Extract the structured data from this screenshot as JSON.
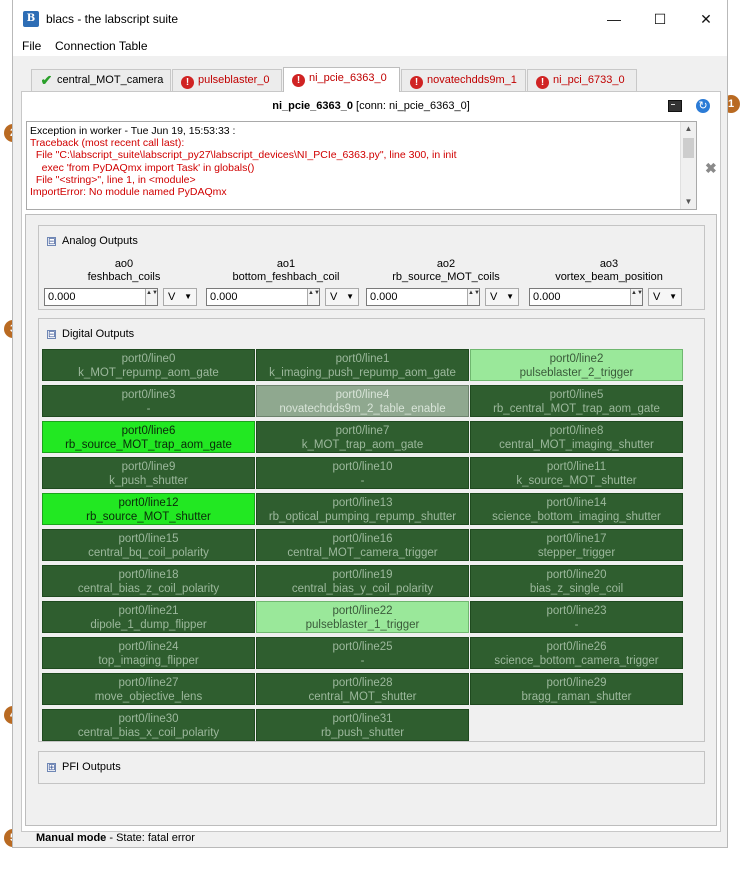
{
  "window": {
    "title": "blacs - the labscript suite",
    "app_icon": "B",
    "min_icon": "—",
    "max_icon": "☐",
    "close_icon": "✕"
  },
  "menu": [
    "File",
    "Connection Table"
  ],
  "tabs": [
    {
      "label": "central_MOT_camera",
      "status": "ok"
    },
    {
      "label": "pulseblaster_0",
      "status": "error"
    },
    {
      "label": "ni_pcie_6363_0",
      "status": "error",
      "active": true
    },
    {
      "label": "novatechdds9m_1",
      "status": "error"
    },
    {
      "label": "ni_pci_6733_0",
      "status": "error"
    }
  ],
  "header": {
    "device": "ni_pcie_6363_0",
    "conn": "[conn: ni_pcie_6363_0]"
  },
  "error_lines": [
    "Exception in worker - Tue Jun 19, 15:53:33 :",
    "Traceback (most recent call last):",
    "  File \"C:\\labscript_suite\\labscript_py27\\labscript_devices\\NI_PCIe_6363.py\", line 300, in init",
    "    exec 'from PyDAQmx import Task' in globals()",
    "  File \"<string>\", line 1, in <module>",
    "ImportError: No module named PyDAQmx"
  ],
  "analog": {
    "title": "Analog Outputs",
    "expander": "⊟",
    "items": [
      {
        "ch": "ao0",
        "name": "feshbach_coils",
        "value": "0.000",
        "unit": "V"
      },
      {
        "ch": "ao1",
        "name": "bottom_feshbach_coil",
        "value": "0.000",
        "unit": "V"
      },
      {
        "ch": "ao2",
        "name": "rb_source_MOT_coils",
        "value": "0.000",
        "unit": "V"
      },
      {
        "ch": "ao3",
        "name": "vortex_beam_position",
        "value": "0.000",
        "unit": "V"
      }
    ]
  },
  "digital": {
    "title": "Digital Outputs",
    "expander": "⊟",
    "items": [
      {
        "port": "port0/line0",
        "name": "k_MOT_repump_aom_gate",
        "state": "off"
      },
      {
        "port": "port0/line1",
        "name": "k_imaging_push_repump_aom_gate",
        "state": "off"
      },
      {
        "port": "port0/line2",
        "name": "pulseblaster_2_trigger",
        "state": "light"
      },
      {
        "port": "port0/line3",
        "name": "-",
        "state": "off"
      },
      {
        "port": "port0/line4",
        "name": "novatechdds9m_2_table_enable",
        "state": "disabled"
      },
      {
        "port": "port0/line5",
        "name": "rb_central_MOT_trap_aom_gate",
        "state": "off"
      },
      {
        "port": "port0/line6",
        "name": "rb_source_MOT_trap_aom_gate",
        "state": "on"
      },
      {
        "port": "port0/line7",
        "name": "k_MOT_trap_aom_gate",
        "state": "off"
      },
      {
        "port": "port0/line8",
        "name": "central_MOT_imaging_shutter",
        "state": "off"
      },
      {
        "port": "port0/line9",
        "name": "k_push_shutter",
        "state": "off"
      },
      {
        "port": "port0/line10",
        "name": "-",
        "state": "off"
      },
      {
        "port": "port0/line11",
        "name": "k_source_MOT_shutter",
        "state": "off"
      },
      {
        "port": "port0/line12",
        "name": "rb_source_MOT_shutter",
        "state": "on"
      },
      {
        "port": "port0/line13",
        "name": "rb_optical_pumping_repump_shutter",
        "state": "off"
      },
      {
        "port": "port0/line14",
        "name": "science_bottom_imaging_shutter",
        "state": "off"
      },
      {
        "port": "port0/line15",
        "name": "central_bq_coil_polarity",
        "state": "off"
      },
      {
        "port": "port0/line16",
        "name": "central_MOT_camera_trigger",
        "state": "off"
      },
      {
        "port": "port0/line17",
        "name": "stepper_trigger",
        "state": "off"
      },
      {
        "port": "port0/line18",
        "name": "central_bias_z_coil_polarity",
        "state": "off"
      },
      {
        "port": "port0/line19",
        "name": "central_bias_y_coil_polarity",
        "state": "off"
      },
      {
        "port": "port0/line20",
        "name": "bias_z_single_coil",
        "state": "off"
      },
      {
        "port": "port0/line21",
        "name": "dipole_1_dump_flipper",
        "state": "off"
      },
      {
        "port": "port0/line22",
        "name": "pulseblaster_1_trigger",
        "state": "light"
      },
      {
        "port": "port0/line23",
        "name": "-",
        "state": "off"
      },
      {
        "port": "port0/line24",
        "name": "top_imaging_flipper",
        "state": "off"
      },
      {
        "port": "port0/line25",
        "name": "-",
        "state": "off"
      },
      {
        "port": "port0/line26",
        "name": "science_bottom_camera_trigger",
        "state": "off"
      },
      {
        "port": "port0/line27",
        "name": "move_objective_lens",
        "state": "off"
      },
      {
        "port": "port0/line28",
        "name": "central_MOT_shutter",
        "state": "off"
      },
      {
        "port": "port0/line29",
        "name": "bragg_raman_shutter",
        "state": "off"
      },
      {
        "port": "port0/line30",
        "name": "central_bias_x_coil_polarity",
        "state": "off"
      },
      {
        "port": "port0/line31",
        "name": "rb_push_shutter",
        "state": "off"
      }
    ]
  },
  "pfi": {
    "title": "PFI Outputs",
    "expander": "⊞"
  },
  "status": {
    "mode": "Manual mode",
    "state": " - State: fatal error"
  },
  "callouts": [
    "1",
    "2",
    "3",
    "4",
    "5"
  ],
  "icons": {
    "ok": "✔",
    "error": "!",
    "spin_arrows": "▲▼",
    "caret": "▼",
    "refresh": "↻",
    "dismiss": "✖",
    "up": "▲",
    "down": "▼"
  }
}
